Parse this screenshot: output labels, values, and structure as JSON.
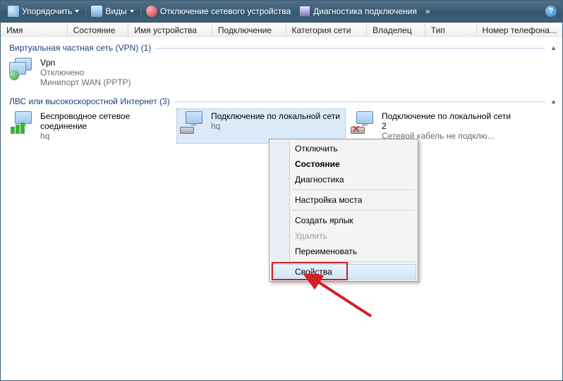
{
  "toolbar": {
    "organize": "Упорядочить",
    "views": "Виды",
    "disable_device": "Отключение сетевого устройства",
    "diagnose": "Диагностика подключения",
    "more": "»"
  },
  "columns": [
    "Имя",
    "Состояние",
    "Имя устройства",
    "Подключение",
    "Категория сети",
    "Владелец",
    "Тип",
    "Номер телефона..."
  ],
  "groups": {
    "vpn": {
      "header": "Виртуальная частная сеть (VPN) (1)",
      "items": [
        {
          "title": "Vpn",
          "sub1": "Отключено",
          "sub2": "Минипорт WAN (PPTP)"
        }
      ]
    },
    "lan": {
      "header": "ЛВС или высокоскоростной Интернет (3)",
      "items": [
        {
          "title": "Беспроводное сетевое соединение",
          "sub1": "hq",
          "sub2": ""
        },
        {
          "title": "Подключение по локальной сети",
          "sub1": "hq",
          "sub2": ""
        },
        {
          "title": "Подключение по локальной сети 2",
          "sub1": "Сетевой кабель не подклю...",
          "sub2": ""
        }
      ]
    }
  },
  "context_menu": {
    "disable": "Отключить",
    "status": "Состояние",
    "diagnose": "Диагностика",
    "bridge": "Настройка моста",
    "shortcut": "Создать ярлык",
    "delete": "Удалить",
    "rename": "Переименовать",
    "properties": "Свойства"
  }
}
